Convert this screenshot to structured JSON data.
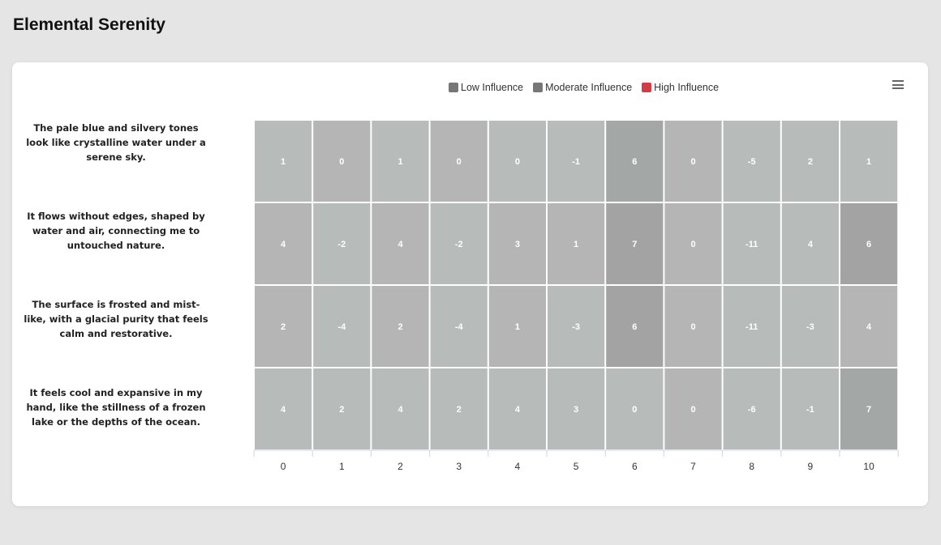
{
  "page": {
    "title": "Elemental Serenity"
  },
  "legend": {
    "items": [
      {
        "label": "Low Influence",
        "color": "#777777"
      },
      {
        "label": "Moderate Influence",
        "color": "#777777"
      },
      {
        "label": "High Influence",
        "color": "#d43c44"
      }
    ]
  },
  "toolbar": {
    "menu_icon": "hamburger-menu-icon"
  },
  "chart_data": {
    "type": "heatmap",
    "title": "",
    "xlabel": "",
    "ylabel": "",
    "x": [
      "0",
      "1",
      "2",
      "3",
      "4",
      "5",
      "6",
      "7",
      "8",
      "9",
      "10"
    ],
    "rows": [
      {
        "label": "The pale blue and silvery tones look like crystalline water under a serene sky.",
        "values": [
          1,
          0,
          1,
          0,
          0,
          -1,
          6,
          0,
          -5,
          2,
          1
        ]
      },
      {
        "label": "It flows without edges, shaped by water and air, connecting me to untouched nature.",
        "values": [
          4,
          -2,
          4,
          -2,
          3,
          1,
          7,
          0,
          -11,
          4,
          6
        ]
      },
      {
        "label": "The surface is frosted and mist-like, with a glacial purity that feels calm and restorative.",
        "values": [
          2,
          -4,
          2,
          -4,
          1,
          -3,
          6,
          0,
          -11,
          -3,
          4
        ]
      },
      {
        "label": "It feels cool and expansive in my hand, like the stillness of a frozen lake or the depths of the ocean.",
        "values": [
          4,
          2,
          4,
          2,
          4,
          3,
          0,
          0,
          -6,
          -1,
          7
        ]
      }
    ],
    "cell_colors": [
      [
        "#b7bcba",
        "#b6b5b5",
        "#b7bcba",
        "#b6b5b5",
        "#b7bcba",
        "#b7bcba",
        "#a3a8a6",
        "#b6b5b5",
        "#b7bcba",
        "#b7bcba",
        "#b7bcba"
      ],
      [
        "#b6b5b5",
        "#b7bcba",
        "#b6b5b5",
        "#b7bcba",
        "#b6b5b5",
        "#b6b5b5",
        "#a3a3a3",
        "#b6b5b5",
        "#b7bcba",
        "#b7bcba",
        "#a3a3a3"
      ],
      [
        "#b6b5b5",
        "#b7bcba",
        "#b6b5b5",
        "#b7bcba",
        "#b6b5b5",
        "#b7bcba",
        "#a3a3a3",
        "#b6b5b5",
        "#b7bcba",
        "#b7bcba",
        "#b6b5b5"
      ],
      [
        "#b7bcba",
        "#b7bcba",
        "#b7bcba",
        "#b7bcba",
        "#b7bcba",
        "#b7bcba",
        "#b7bcba",
        "#b6b5b5",
        "#b7bcba",
        "#b7bcba",
        "#a3a8a6"
      ]
    ],
    "grid": false,
    "legend_position": "top-center"
  }
}
